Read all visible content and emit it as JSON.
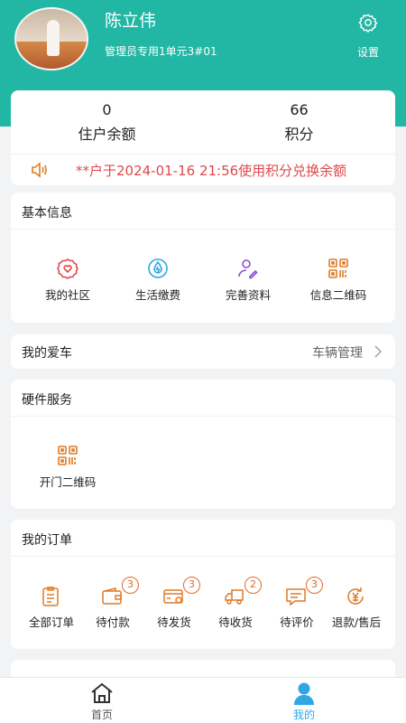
{
  "colors": {
    "accent": "#22b6a4",
    "notice": "#e0474b",
    "icon_orange": "#e07a25",
    "icon_blue": "#2fa7e6",
    "icon_purple": "#8b4dd8",
    "icon_red": "#e0474b",
    "tab_active": "#2fa7e6"
  },
  "user": {
    "name": "陈立伟",
    "address": "管理员专用1单元3#01"
  },
  "header": {
    "settings_label": "设置",
    "settings_icon": "gear-icon"
  },
  "stats": [
    {
      "value": "0",
      "label": "住户余额"
    },
    {
      "value": "66",
      "label": "积分"
    }
  ],
  "notice": {
    "icon": "speaker-icon",
    "text": "**户于2024-01-16 21:56使用积分兑换余额"
  },
  "basic_info": {
    "title": "基本信息",
    "items": [
      {
        "label": "我的社区",
        "icon": "community-heart-icon"
      },
      {
        "label": "生活缴费",
        "icon": "water-drop-icon"
      },
      {
        "label": "完善资料",
        "icon": "edit-profile-icon"
      },
      {
        "label": "信息二维码",
        "icon": "qr-code-icon"
      }
    ]
  },
  "car": {
    "title": "我的爱车",
    "manage_label": "车辆管理"
  },
  "hardware": {
    "title": "硬件服务",
    "items": [
      {
        "label": "开门二维码",
        "icon": "qr-code-icon"
      }
    ]
  },
  "orders": {
    "title": "我的订单",
    "items": [
      {
        "label": "全部订单",
        "icon": "order-list-icon",
        "badge": ""
      },
      {
        "label": "待付款",
        "icon": "wallet-icon",
        "badge": "3"
      },
      {
        "label": "待发货",
        "icon": "card-ship-icon",
        "badge": "3"
      },
      {
        "label": "待收货",
        "icon": "truck-icon",
        "badge": "2"
      },
      {
        "label": "待评价",
        "icon": "comment-icon",
        "badge": "3"
      },
      {
        "label": "退款/售后",
        "icon": "refund-icon",
        "badge": ""
      }
    ]
  },
  "tabbar": [
    {
      "label": "首页",
      "icon": "home-icon",
      "active": false
    },
    {
      "label": "我的",
      "icon": "person-icon",
      "active": true
    }
  ]
}
